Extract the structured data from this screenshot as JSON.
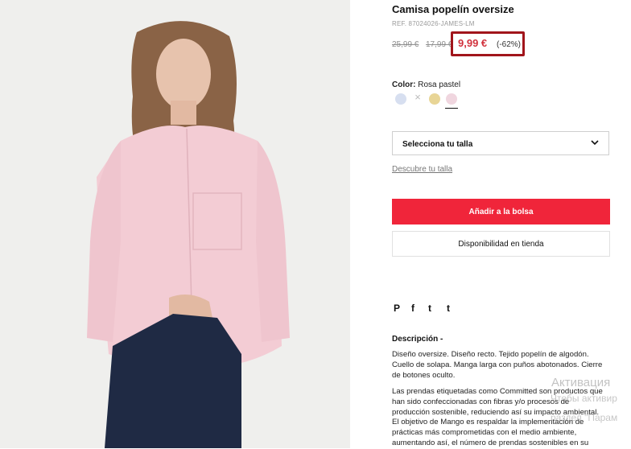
{
  "product": {
    "title": "Camisa popelín oversize",
    "ref": "REF. 87024026-JAMES-LM",
    "old_price_1": "25,99 €",
    "old_price_2": "17,99 €",
    "sale_price": "9,99 €",
    "discount": "(-62%)",
    "color_label": "Color:",
    "color_value": "Rosa pastel",
    "swatches": [
      {
        "name": "light-blue",
        "color": "#d7dff0"
      },
      {
        "name": "unavailable",
        "symbol": "×"
      },
      {
        "name": "yellow",
        "color": "#e8d596"
      },
      {
        "name": "pink",
        "color": "#f0d6df",
        "selected": true
      }
    ],
    "size_select_label": "Selecciona tu talla",
    "size_guide_link": "Descubre tu talla",
    "add_to_bag": "Añadir a la bolsa",
    "store_availability": "Disponibilidad en tienda",
    "social_icons": [
      "pinterest-icon",
      "facebook-icon",
      "twitter-icon",
      "tumblr-icon"
    ],
    "social_labels": {
      "pinterest": "P",
      "facebook": "f",
      "twitter": "t",
      "tumblr": "t"
    },
    "description_title": "Descripción -",
    "description_p1": "Diseño oversize. Diseño recto. Tejido popelín de algodón. Cuello de solapa. Manga larga con puños abotonados. Cierre de botones oculto.",
    "description_p2": "Las prendas etiquetadas como Committed son productos que han sido confeccionadas con fibras y/o procesos de producción sostenible, reduciendo así su impacto ambiental. El objetivo de Mango es respaldar la implementación de prácticas más comprometidas con el medio ambiente, aumentando así, el número de prendas sostenibles en su"
  },
  "colors": {
    "accent_red": "#f0253a",
    "sale_red": "#d1323d",
    "highlight_box": "#a1151b"
  },
  "watermark": {
    "line1": "Активация",
    "line2": "Чтобы активир",
    "line3": "раздел \"Парам"
  }
}
